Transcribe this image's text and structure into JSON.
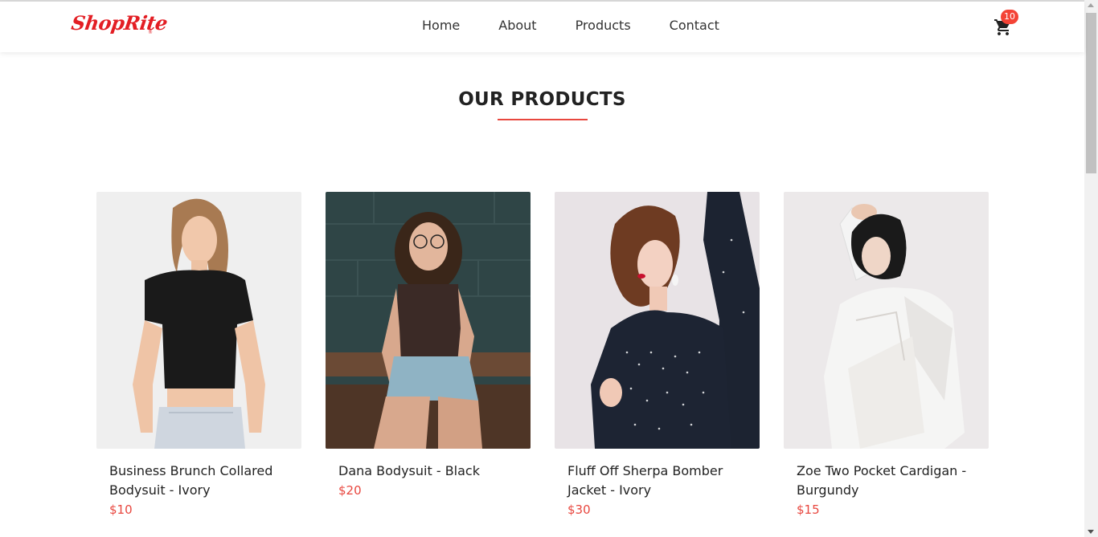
{
  "brand": {
    "logo_text": "ShopRite",
    "logo_mark": "®",
    "color": "#e31e24"
  },
  "nav": {
    "links": [
      {
        "label": "Home"
      },
      {
        "label": "About"
      },
      {
        "label": "Products"
      },
      {
        "label": "Contact"
      }
    ]
  },
  "cart": {
    "icon": "shopping-cart-icon",
    "count": "10",
    "badge_color": "#f44336"
  },
  "section": {
    "title": "OUR PRODUCTS",
    "accent": "#e8473f"
  },
  "products": [
    {
      "name": "Business Brunch Collared Bodysuit - Ivory",
      "price": "$10",
      "image": "woman in black crop top and denim shorts"
    },
    {
      "name": "Dana Bodysuit - Black",
      "price": "$20",
      "image": "woman with glasses seated on wooden bench"
    },
    {
      "name": "Fluff Off Sherpa Bomber Jacket - Ivory",
      "price": "$30",
      "image": "woman in polka-dot blouse"
    },
    {
      "name": "Zoe Two Pocket Cardigan - Burgundy",
      "price": "$15",
      "image": "woman in white draped outfit"
    }
  ]
}
